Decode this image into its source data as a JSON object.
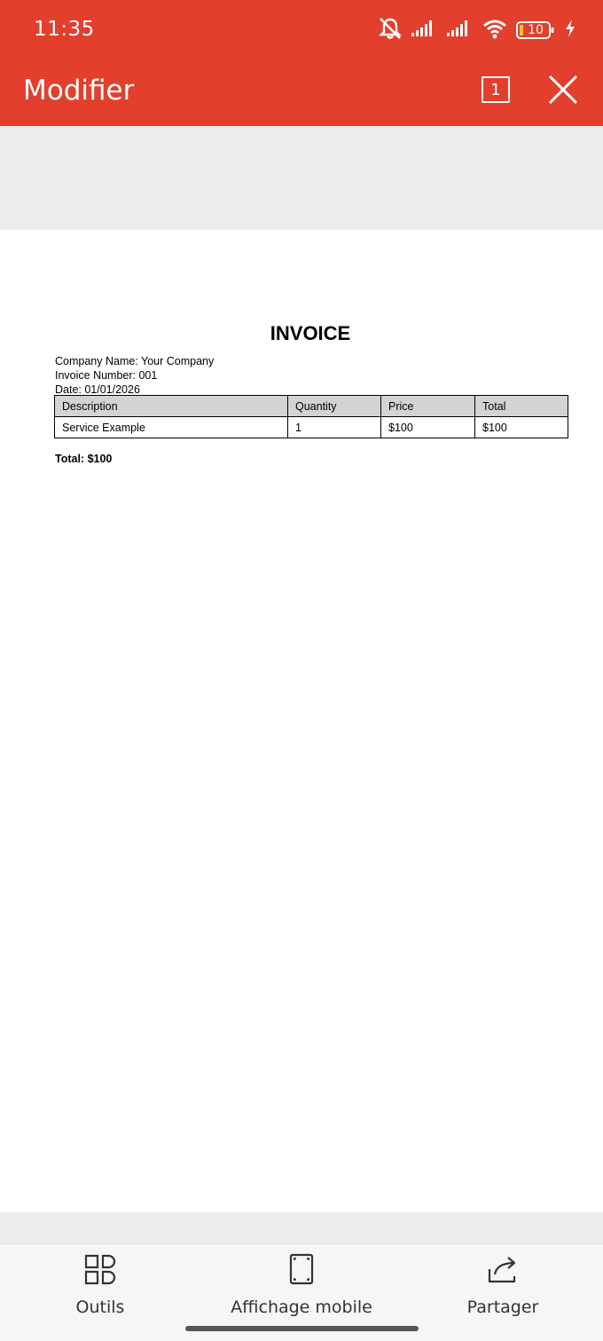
{
  "status_bar": {
    "time": "11:35",
    "battery_level": "10",
    "icons": [
      "bell-muted-icon",
      "signal-icon",
      "signal-icon",
      "wifi-icon",
      "battery-icon",
      "charging-icon"
    ]
  },
  "app_bar": {
    "title": "Modifier",
    "page_count": "1",
    "background_color": "#e23f2c"
  },
  "document": {
    "title": "INVOICE",
    "company_line": "Company Name: Your Company",
    "invoice_number_line": "Invoice Number: 001",
    "date_line": "Date: 01/01/2026",
    "table": {
      "headers": [
        "Description",
        "Quantity",
        "Price",
        "Total"
      ],
      "rows": [
        [
          "Service Example",
          "1",
          "$100",
          "$100"
        ]
      ]
    },
    "total_line": "Total: $100"
  },
  "bottom_bar": {
    "tools_label": "Outils",
    "mobile_view_label": "Affichage mobile",
    "share_label": "Partager"
  }
}
